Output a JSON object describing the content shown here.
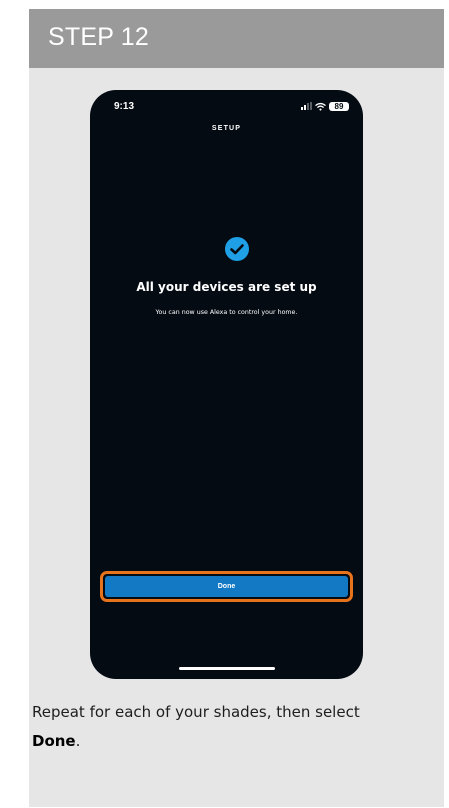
{
  "step": {
    "title": "STEP 12"
  },
  "phone": {
    "status_bar": {
      "time": "9:13",
      "battery": "89"
    },
    "header": {
      "title": "SETUP"
    },
    "success": {
      "heading": "All your devices are set up",
      "subtitle": "You can now use Alexa to control your home."
    },
    "done_button": {
      "label": "Done"
    }
  },
  "instruction": {
    "text_before": "Repeat for each of your shades, then select ",
    "emphasis": "Done",
    "text_after": "."
  },
  "colors": {
    "header_bg": "#9a9a9a",
    "card_bg": "#e6e6e7",
    "phone_bg": "#050b13",
    "check_blue": "#1fa0e6",
    "button_blue": "#1479c4",
    "highlight_orange": "#e8731d"
  }
}
